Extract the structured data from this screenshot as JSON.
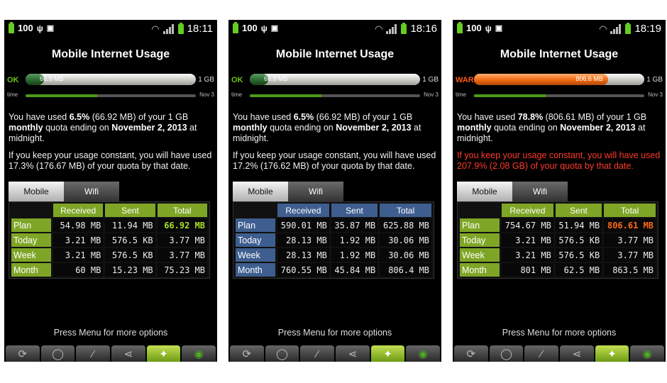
{
  "colors": {
    "green": "#7fa526",
    "blue": "#3e5e8f",
    "orange": "#ee6a10",
    "warn_red": "#ff3a2a"
  },
  "common": {
    "title": "Mobile Internet Usage",
    "quota_label": "1 GB",
    "time_label": "time",
    "end_date": "Nov 3",
    "tab_mobile": "Mobile",
    "tab_wifi": "Wifi",
    "col_received": "Received",
    "col_sent": "Sent",
    "col_total": "Total",
    "menu_hint": "Press Menu for more options",
    "bottom_icons": [
      "refresh-icon",
      "globe-icon",
      "graph-icon",
      "share-icon",
      "dog-icon",
      "signal-icon"
    ]
  },
  "phones": [
    {
      "battery": "100",
      "time": "18:11",
      "state": "OK",
      "state_color": "#6fc21a",
      "bar_label": "66.9 MB",
      "bar_fraction": 0.065,
      "bar_fill": "#2b6a2f",
      "time_fraction": 0.42,
      "p1_a": "You have used ",
      "p1_pct": "6.5%",
      "p1_b": " (66.92 MB) of your 1 GB ",
      "p1_c": "monthly",
      "p1_d": " quota ending on ",
      "p1_date": "November 2, 2013",
      "p1_e": " at midnight.",
      "p2": "If you keep your usage constant, you will have used 17.3% (176.67 MB) of your quota by that date.",
      "p2_warn": false,
      "theme": "green",
      "total_color": "#a8e02b",
      "rows": [
        {
          "label": "Plan",
          "received": "54.98 MB",
          "sent": "11.94 MB",
          "total": "66.92 MB"
        },
        {
          "label": "Today",
          "received": "3.21 MB",
          "sent": "576.5 KB",
          "total": "3.77 MB"
        },
        {
          "label": "Week",
          "received": "3.21 MB",
          "sent": "576.5 KB",
          "total": "3.77 MB"
        },
        {
          "label": "Month",
          "received": "60 MB",
          "sent": "15.23 MB",
          "total": "75.23 MB"
        }
      ]
    },
    {
      "battery": "100",
      "time": "18:16",
      "state": "OK",
      "state_color": "#6fc21a",
      "bar_label": "66.9 MB",
      "bar_fraction": 0.065,
      "bar_fill": "#2b6a2f",
      "time_fraction": 0.42,
      "p1_a": "You have used ",
      "p1_pct": "6.5%",
      "p1_b": " (66.92 MB) of your 1 GB ",
      "p1_c": "monthly",
      "p1_d": " quota ending on ",
      "p1_date": "November 2, 2013",
      "p1_e": " at midnight.",
      "p2": "If you keep your usage constant, you will have used 17.2% (176.62 MB) of your quota by that date.",
      "p2_warn": false,
      "theme": "blue",
      "total_color": "#eeeeee",
      "rows": [
        {
          "label": "Plan",
          "received": "590.01 MB",
          "sent": "35.87 MB",
          "total": "625.88 MB"
        },
        {
          "label": "Today",
          "received": "28.13 MB",
          "sent": "1.92 MB",
          "total": "30.06 MB"
        },
        {
          "label": "Week",
          "received": "28.13 MB",
          "sent": "1.92 MB",
          "total": "30.06 MB"
        },
        {
          "label": "Month",
          "received": "760.55 MB",
          "sent": "45.84 MB",
          "total": "806.4 MB"
        }
      ]
    },
    {
      "battery": "100",
      "time": "18:19",
      "state": "WARN",
      "state_color": "#ff5a1a",
      "bar_label": "806.6 MB",
      "bar_fraction": 0.788,
      "bar_fill": "#ee6a10",
      "time_fraction": 0.42,
      "p1_a": "You have used ",
      "p1_pct": "78.8%",
      "p1_b": " (806.61 MB) of your 1 GB ",
      "p1_c": "monthly",
      "p1_d": " quota ending on ",
      "p1_date": "November 2, 2013",
      "p1_e": " at midnight.",
      "p2": "If you keep your usage constant, you will have used 207.9% (2.08 GB) of your quota by that date.",
      "p2_warn": true,
      "theme": "green",
      "total_color": "#ff6a1a",
      "rows": [
        {
          "label": "Plan",
          "received": "754.67 MB",
          "sent": "51.94 MB",
          "total": "806.61 MB"
        },
        {
          "label": "Today",
          "received": "3.21 MB",
          "sent": "576.5 KB",
          "total": "3.77 MB"
        },
        {
          "label": "Week",
          "received": "3.21 MB",
          "sent": "576.5 KB",
          "total": "3.77 MB"
        },
        {
          "label": "Month",
          "received": "801 MB",
          "sent": "62.5 MB",
          "total": "863.5 MB"
        }
      ]
    }
  ]
}
